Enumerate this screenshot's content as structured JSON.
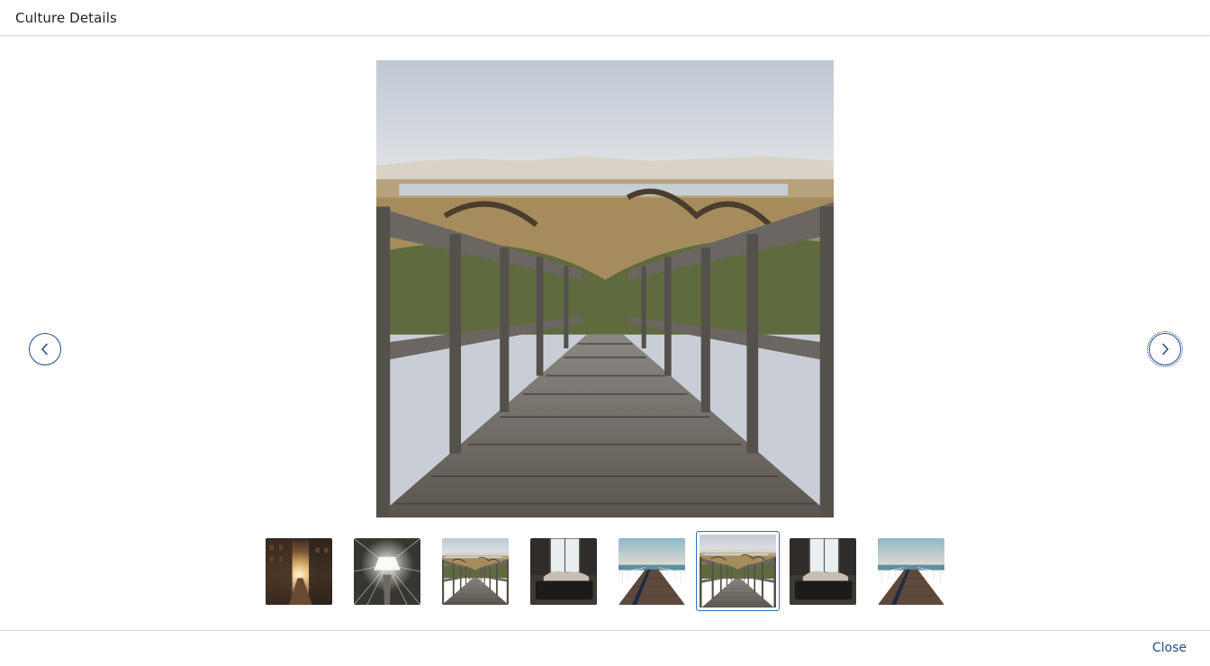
{
  "dialog": {
    "title": "Culture Details",
    "close_label": "Close"
  },
  "viewer": {
    "main_image": "wooden-boardwalk-photo",
    "prev_icon": "chevron-left-icon",
    "next_icon": "chevron-right-icon"
  },
  "thumbnails": [
    {
      "image": "city-street-sunset-photo",
      "active": false
    },
    {
      "image": "skylight-atrium-photo",
      "active": false
    },
    {
      "image": "wooden-boardwalk-photo",
      "active": false
    },
    {
      "image": "window-sofa-photo",
      "active": false
    },
    {
      "image": "pier-ocean-photo",
      "active": false
    },
    {
      "image": "wooden-boardwalk-photo",
      "active": true
    },
    {
      "image": "window-sofa-photo",
      "active": false
    },
    {
      "image": "pier-ocean-photo",
      "active": false
    }
  ],
  "colors": {
    "accent": "#1f4f8a",
    "active_border": "#2e6fc0"
  }
}
